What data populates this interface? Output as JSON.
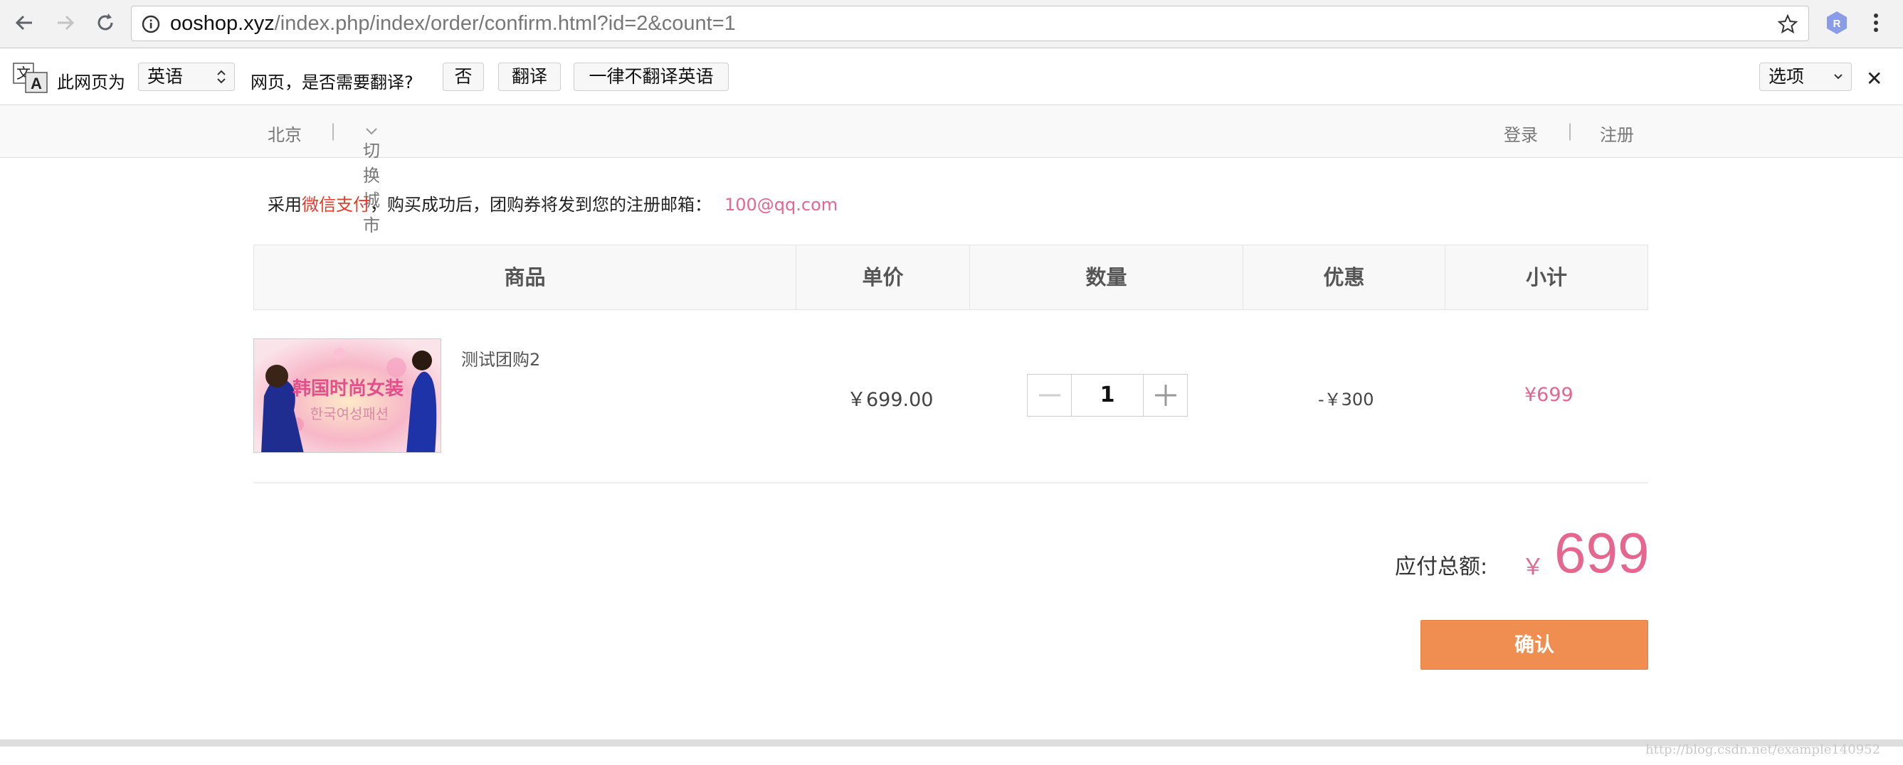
{
  "browser": {
    "url_host": "ooshop.xyz",
    "url_path": "/index.php/index/order/confirm.html?id=2&count=1"
  },
  "translate_bar": {
    "prefix": "此网页为",
    "language": "英语",
    "question": "网页，是否需要翻译?",
    "no_button": "否",
    "translate_button": "翻译",
    "never_button": "一律不翻译英语",
    "options": "选项"
  },
  "site_bar": {
    "city": "北京",
    "separator": "|",
    "switch_city": "切换城市",
    "login": "登录",
    "register": "注册"
  },
  "notice": {
    "prefix": "采用",
    "payment": "微信支付",
    "middle": "，购买成功后，团购券将发到您的注册邮箱：",
    "email": "100@qq.com"
  },
  "table": {
    "headers": [
      "商品",
      "单价",
      "数量",
      "优惠",
      "小计"
    ],
    "row": {
      "name": "测试团购2",
      "image_text": "韩国时尚女装",
      "image_subtext": "한국여성패션",
      "unit_price": "￥699.00",
      "quantity": "1",
      "discount": "-￥300",
      "subtotal": "¥699"
    }
  },
  "total": {
    "label": "应付总额:",
    "currency": "￥",
    "amount": "699"
  },
  "confirm_label": "确认",
  "watermark": "http://blog.csdn.net/example140952",
  "colors": {
    "accent_pink": "#e5668e",
    "notice_red": "#e43b2b",
    "confirm_orange": "#f08d50"
  }
}
